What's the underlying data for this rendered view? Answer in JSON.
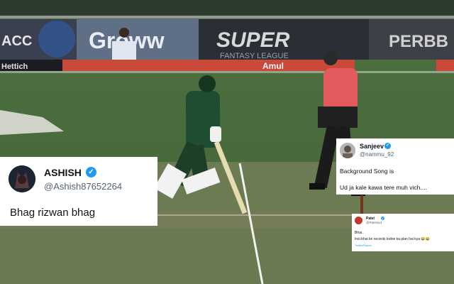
{
  "scene": {
    "description_icon": "cricket-match-scene"
  },
  "billboards": {
    "acc": "ACC",
    "groww": "Groww",
    "super": "SUPER",
    "super_sub": "FANTASY LEAGUE",
    "right": "PERBB",
    "hettich": "Hettich",
    "amul": "Amul"
  },
  "tweets": [
    {
      "name": "ASHISH",
      "handle": "@Ashish87652264",
      "lines": [
        "Bhag rizwan bhag"
      ]
    },
    {
      "name": "Sanjeev",
      "handle": "@nammu_92",
      "lines": [
        "Background Song is",
        "Ud ja kale kawa tere muh vich...."
      ]
    },
    {
      "name": "Patel",
      "handle": "@Patelzyd",
      "lines": [
        "Bhai..",
        "Inzi bhai ke records todne ka plan hai kya 😂😂"
      ],
      "source": "Twitter/Report"
    }
  ],
  "colors": {
    "pitch": "#8a8b68",
    "outfield": "#4b6b3c",
    "umpire_shirt": "#e35b5f",
    "kit_green": "#1f4d31",
    "verified": "#1d9bf0"
  }
}
